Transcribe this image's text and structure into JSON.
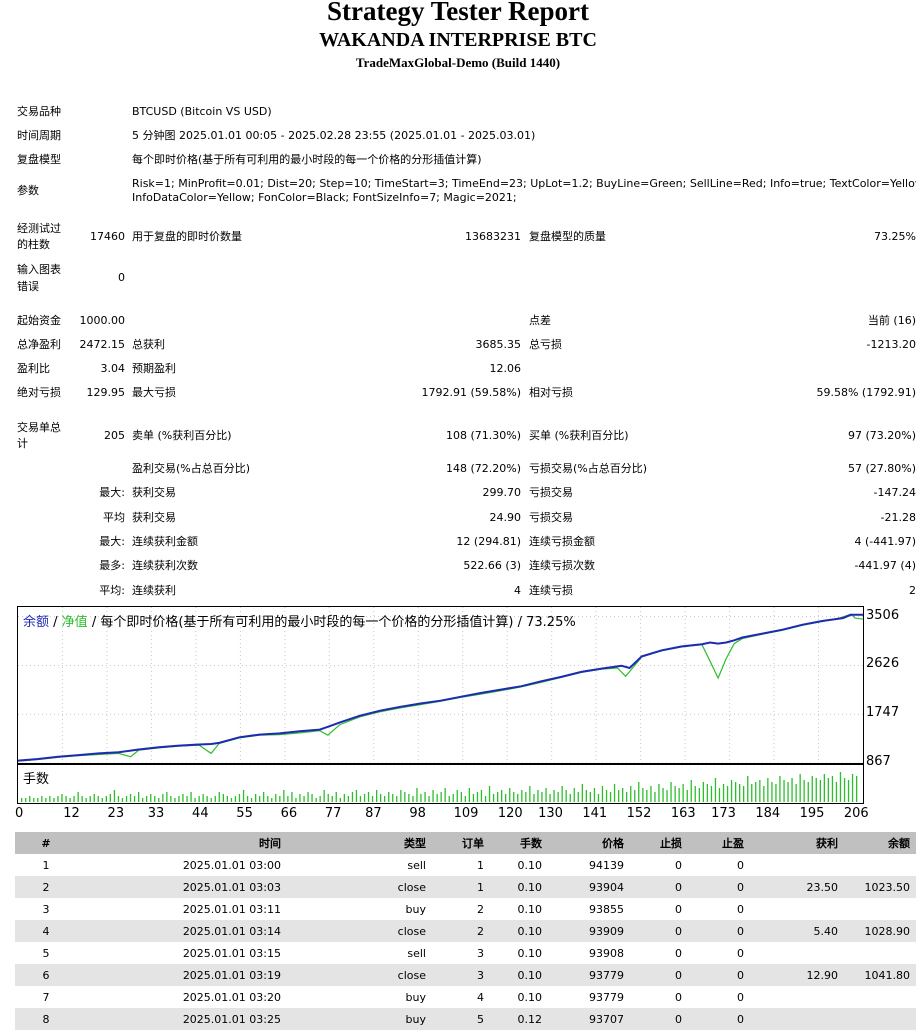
{
  "header": {
    "title": "Strategy Tester Report",
    "subtitle": "WAKANDA INTERPRISE BTC",
    "server": "TradeMaxGlobal-Demo (Build 1440)"
  },
  "settings": {
    "symbol_label": "交易品种",
    "symbol_value": "BTCUSD (Bitcoin VS USD)",
    "period_label": "时间周期",
    "period_value": "5 分钟图 2025.01.01 00:05 - 2025.02.28 23:55 (2025.01.01 - 2025.03.01)",
    "model_label": "复盘模型",
    "model_value": "每个即时价格(基于所有可利用的最小时段的每一个价格的分形插值计算)",
    "params_label": "参数",
    "params_line1": "Risk=1; MinProfit=0.01; Dist=20; Step=10; TimeStart=3; TimeEnd=23; UpLot=1.2; BuyLine=Green; SellLine=Red; Info=true; TextColor=Yellow;",
    "params_line2": "InfoDataColor=Yellow; FonColor=Black; FontSizeInfo=7; Magic=2021;"
  },
  "stats": {
    "bars_label_1": "经测试过",
    "bars_label_2": "的柱数",
    "bars_value": "17460",
    "ticks_label": "用于复盘的即时价数量",
    "ticks_value": "13683231",
    "quality_label": "复盘模型的质量",
    "quality_value": "73.25%",
    "errors_label_1": "输入图表",
    "errors_label_2": "错误",
    "errors_value": "0",
    "deposit_label": "起始资金",
    "deposit_value": "1000.00",
    "spread_label": "点差",
    "spread_value": "当前 (16)",
    "net_label": "总净盈利",
    "net_value": "2472.15",
    "gross_profit_label": "总获利",
    "gross_profit_value": "3685.35",
    "gross_loss_label": "总亏损",
    "gross_loss_value": "-1213.20",
    "pf_label": "盈利比",
    "pf_value": "3.04",
    "payoff_label": "预期盈利",
    "payoff_value": "12.06",
    "abs_dd_label": "绝对亏损",
    "abs_dd_value": "129.95",
    "max_dd_label": "最大亏损",
    "max_dd_value": "1792.91 (59.58%)",
    "rel_dd_label": "相对亏损",
    "rel_dd_value": "59.58% (1792.91)",
    "trades_label_1": "交易单总",
    "trades_label_2": "计",
    "trades_value": "205",
    "short_label": "卖单 (%获利百分比)",
    "short_value": "108 (71.30%)",
    "long_label": "买单 (%获利百分比)",
    "long_value": "97 (73.20%)",
    "profit_trades_label": "盈利交易(%占总百分比)",
    "profit_trades_value": "148 (72.20%)",
    "loss_trades_label": "亏损交易(%占总百分比)",
    "loss_trades_value": "57 (27.80%)",
    "largest_label": "最大:",
    "largest_profit_label": "获利交易",
    "largest_profit_value": "299.70",
    "largest_loss_label": "亏损交易",
    "largest_loss_value": "-147.24",
    "average_label": "平均",
    "avg_profit_label": "获利交易",
    "avg_profit_value": "24.90",
    "avg_loss_label": "亏损交易",
    "avg_loss_value": "-21.28",
    "max_label": "最大:",
    "max_consec_wins_label": "连续获利金额",
    "max_consec_wins_value": "12 (294.81)",
    "max_consec_losses_label": "连续亏损金额",
    "max_consec_losses_value": "4 (-441.97)",
    "maximal_label": "最多:",
    "maximal_profit_label": "连续获利次数",
    "maximal_profit_value": "522.66 (3)",
    "maximal_loss_label": "连续亏损次数",
    "maximal_loss_value": "-441.97 (4)",
    "avg2_label": "平均:",
    "avg_consec_wins_label": "连续获利",
    "avg_consec_wins_value": "4",
    "avg_consec_losses_label": "连续亏损",
    "avg_consec_losses_value": "2"
  },
  "chart_data": {
    "type": "line",
    "legend_balance": "余额",
    "legend_sep1": " / ",
    "legend_equity": "净值",
    "legend_rest": " / 每个即时价格(基于所有可利用的最小时段的每一个价格的分形插值计算) / 73.25%",
    "volume_label": "手数",
    "y_ticks": [
      "3506",
      "2626",
      "1747",
      "867"
    ],
    "x_ticks": [
      "0",
      "12",
      "23",
      "33",
      "44",
      "55",
      "66",
      "77",
      "87",
      "98",
      "109",
      "120",
      "130",
      "141",
      "152",
      "163",
      "173",
      "184",
      "195",
      "206"
    ],
    "ylim": [
      867,
      3680
    ],
    "xlim": [
      0,
      210
    ],
    "colors": {
      "balance": "#1f2ab4",
      "equity": "#2cbf2c",
      "volume": "#2cbf2c",
      "legend_balance": "#1f2ab4",
      "legend_equity": "#2cbf2c"
    },
    "series": [
      {
        "name": "余额",
        "x": [
          0,
          5,
          10,
          15,
          20,
          25,
          28,
          30,
          35,
          40,
          45,
          48,
          50,
          55,
          60,
          65,
          70,
          75,
          77,
          80,
          85,
          90,
          95,
          100,
          105,
          110,
          115,
          120,
          125,
          130,
          135,
          140,
          145,
          150,
          152,
          155,
          160,
          165,
          170,
          172,
          174,
          176,
          178,
          180,
          185,
          190,
          195,
          200,
          203,
          205,
          207,
          210
        ],
        "y": [
          910,
          940,
          980,
          1010,
          1040,
          1060,
          1090,
          1110,
          1150,
          1180,
          1200,
          1210,
          1230,
          1330,
          1380,
          1400,
          1440,
          1470,
          1520,
          1600,
          1720,
          1810,
          1880,
          1940,
          1990,
          2060,
          2130,
          2190,
          2250,
          2340,
          2420,
          2510,
          2570,
          2620,
          2580,
          2790,
          2900,
          2970,
          3010,
          3040,
          3020,
          3040,
          3080,
          3130,
          3200,
          3270,
          3360,
          3430,
          3460,
          3480,
          3540,
          3540
        ]
      },
      {
        "name": "净值",
        "x": [
          0,
          5,
          10,
          15,
          20,
          25,
          28,
          30,
          35,
          40,
          45,
          48,
          50,
          55,
          60,
          65,
          70,
          75,
          77,
          80,
          85,
          90,
          95,
          100,
          105,
          110,
          115,
          120,
          125,
          130,
          135,
          140,
          145,
          149,
          151,
          153,
          155,
          160,
          165,
          170,
          172,
          174,
          176,
          178,
          180,
          185,
          190,
          195,
          200,
          203,
          205,
          207,
          208,
          210
        ],
        "y": [
          900,
          930,
          970,
          1000,
          1020,
          1040,
          980,
          1100,
          1140,
          1170,
          1190,
          1040,
          1220,
          1320,
          1370,
          1380,
          1410,
          1450,
          1370,
          1560,
          1700,
          1790,
          1860,
          1920,
          1980,
          2050,
          2110,
          2170,
          2240,
          2320,
          2410,
          2500,
          2560,
          2580,
          2430,
          2600,
          2780,
          2890,
          2960,
          3000,
          2700,
          2400,
          2750,
          3020,
          3110,
          3190,
          3260,
          3350,
          3420,
          3460,
          3500,
          3550,
          3480,
          3460
        ]
      }
    ],
    "volume": [
      2,
      2,
      3,
      2,
      2,
      3,
      2,
      3,
      2,
      3,
      4,
      3,
      2,
      3,
      5,
      3,
      2,
      3,
      4,
      3,
      2,
      3,
      4,
      6,
      3,
      2,
      3,
      4,
      3,
      5,
      2,
      3,
      4,
      3,
      2,
      4,
      5,
      3,
      2,
      3,
      4,
      3,
      5,
      2,
      3,
      4,
      3,
      2,
      3,
      5,
      4,
      3,
      2,
      3,
      4,
      6,
      3,
      2,
      4,
      3,
      5,
      3,
      2,
      4,
      3,
      6,
      3,
      5,
      2,
      4,
      3,
      5,
      4,
      2,
      3,
      6,
      4,
      3,
      5,
      2,
      4,
      3,
      5,
      6,
      3,
      4,
      5,
      3,
      6,
      4,
      3,
      5,
      4,
      3,
      6,
      5,
      4,
      3,
      7,
      4,
      5,
      3,
      6,
      4,
      5,
      7,
      3,
      4,
      6,
      5,
      3,
      7,
      4,
      5,
      6,
      3,
      8,
      4,
      5,
      6,
      4,
      7,
      5,
      4,
      6,
      5,
      8,
      4,
      6,
      5,
      7,
      4,
      6,
      5,
      8,
      6,
      4,
      7,
      5,
      9,
      6,
      5,
      7,
      4,
      8,
      6,
      5,
      9,
      6,
      7,
      5,
      8,
      6,
      10,
      7,
      6,
      8,
      5,
      9,
      7,
      6,
      10,
      8,
      7,
      9,
      6,
      11,
      8,
      7,
      10,
      9,
      8,
      12,
      7,
      9,
      8,
      11,
      10,
      9,
      8,
      13,
      9,
      10,
      11,
      8,
      12,
      10,
      9,
      13,
      11,
      10,
      12,
      9,
      14,
      11,
      10,
      13,
      12,
      11,
      14,
      12,
      13,
      10,
      15,
      12,
      11,
      14,
      13
    ]
  },
  "deals": {
    "headers": [
      "#",
      "时间",
      "类型",
      "订单",
      "手数",
      "价格",
      "止损",
      "止盈",
      "获利",
      "余额"
    ],
    "rows": [
      [
        "1",
        "2025.01.01 03:00",
        "sell",
        "1",
        "0.10",
        "94139",
        "0",
        "0",
        "",
        ""
      ],
      [
        "2",
        "2025.01.01 03:03",
        "close",
        "1",
        "0.10",
        "93904",
        "0",
        "0",
        "23.50",
        "1023.50"
      ],
      [
        "3",
        "2025.01.01 03:11",
        "buy",
        "2",
        "0.10",
        "93855",
        "0",
        "0",
        "",
        ""
      ],
      [
        "4",
        "2025.01.01 03:14",
        "close",
        "2",
        "0.10",
        "93909",
        "0",
        "0",
        "5.40",
        "1028.90"
      ],
      [
        "5",
        "2025.01.01 03:15",
        "sell",
        "3",
        "0.10",
        "93908",
        "0",
        "0",
        "",
        ""
      ],
      [
        "6",
        "2025.01.01 03:19",
        "close",
        "3",
        "0.10",
        "93779",
        "0",
        "0",
        "12.90",
        "1041.80"
      ],
      [
        "7",
        "2025.01.01 03:20",
        "buy",
        "4",
        "0.10",
        "93779",
        "0",
        "0",
        "",
        ""
      ],
      [
        "8",
        "2025.01.01 03:25",
        "buy",
        "5",
        "0.12",
        "93707",
        "0",
        "0",
        "",
        ""
      ]
    ]
  }
}
